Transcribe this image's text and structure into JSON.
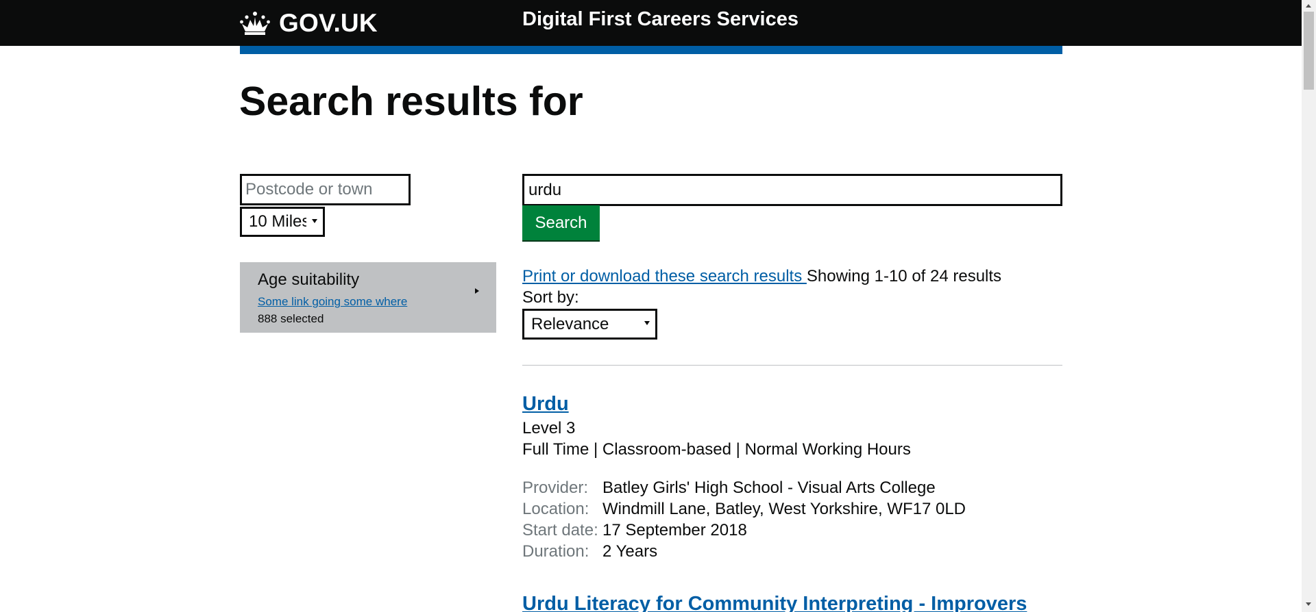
{
  "header": {
    "logo_text": "GOV.UK",
    "service_name": "Digital First Careers Services",
    "bar_color": "#0b0c0c",
    "accent_color": "#005ea5"
  },
  "page_title": "Search results for",
  "filters": {
    "postcode_placeholder": "Postcode or town",
    "postcode_value": "",
    "distance_selected": "10 Miles",
    "facet": {
      "title": "Age suitability",
      "link": "Some link going some where",
      "count": "888 selected",
      "icon": "triangle-right-icon"
    }
  },
  "search": {
    "value": "urdu",
    "button_label": "Search",
    "button_color": "#00823b"
  },
  "results_summary": {
    "print_link": "Print or download these search results ",
    "showing": "Showing 1-10 of 24 results",
    "sort_label": "Sort by:",
    "sort_selected": "Relevance"
  },
  "results": [
    {
      "title": "Urdu",
      "level": "Level 3",
      "attributes": "Full Time | Classroom-based | Normal Working Hours",
      "meta": [
        {
          "label": "Provider:",
          "value": "Batley Girls' High School - Visual Arts College"
        },
        {
          "label": "Location:",
          "value": "Windmill Lane, Batley, West Yorkshire, WF17 0LD"
        },
        {
          "label": "Start date:",
          "value": "17 September 2018"
        },
        {
          "label": "Duration:",
          "value": "2 Years"
        }
      ]
    },
    {
      "title": "Urdu Literacy for Community Interpreting - Improvers"
    }
  ]
}
